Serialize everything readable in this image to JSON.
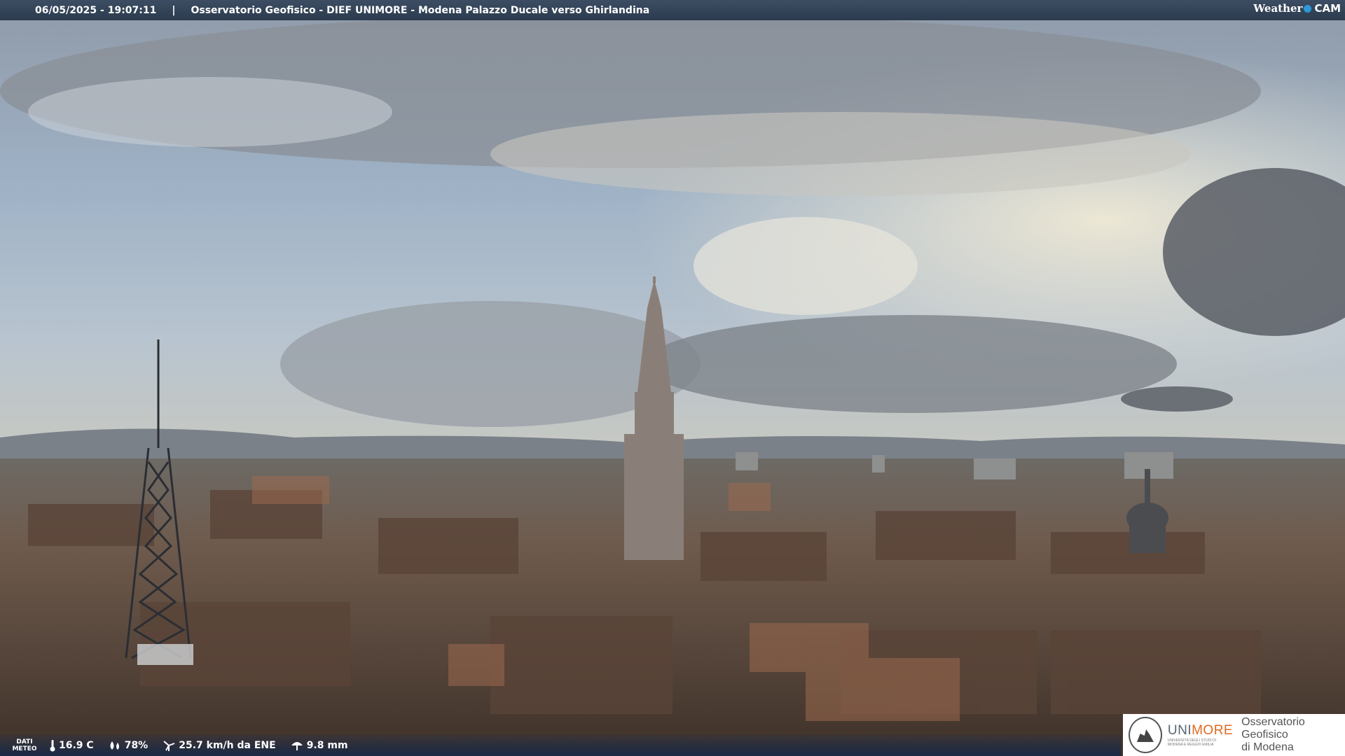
{
  "header": {
    "timestamp": "06/05/2025 - 19:07:11",
    "separator": "|",
    "title": "Osservatorio Geofisico - DIEF UNIMORE - Modena Palazzo Ducale verso Ghirlandina",
    "logo_weather": "Weather",
    "logo_cam": "CAM"
  },
  "weather": {
    "label_line1": "DATI",
    "label_line2": "METEO",
    "temperature": "16.9 C",
    "humidity": "78%",
    "wind": "25.7 km/h da ENE",
    "rain": "9.8 mm"
  },
  "branding": {
    "uni_a": "UNI",
    "uni_b": "MORE",
    "uni_sub1": "UNIVERSITÀ DEGLI STUDI DI",
    "uni_sub2": "MODENA E REGGIO EMILIA",
    "observatory_line1": "Osservatorio Geofisico",
    "observatory_line2": "di Modena"
  },
  "colors": {
    "topbar": "#33445a",
    "unimore_accent": "#e06a1f",
    "weathercam_dot": "#2a9ad8"
  }
}
